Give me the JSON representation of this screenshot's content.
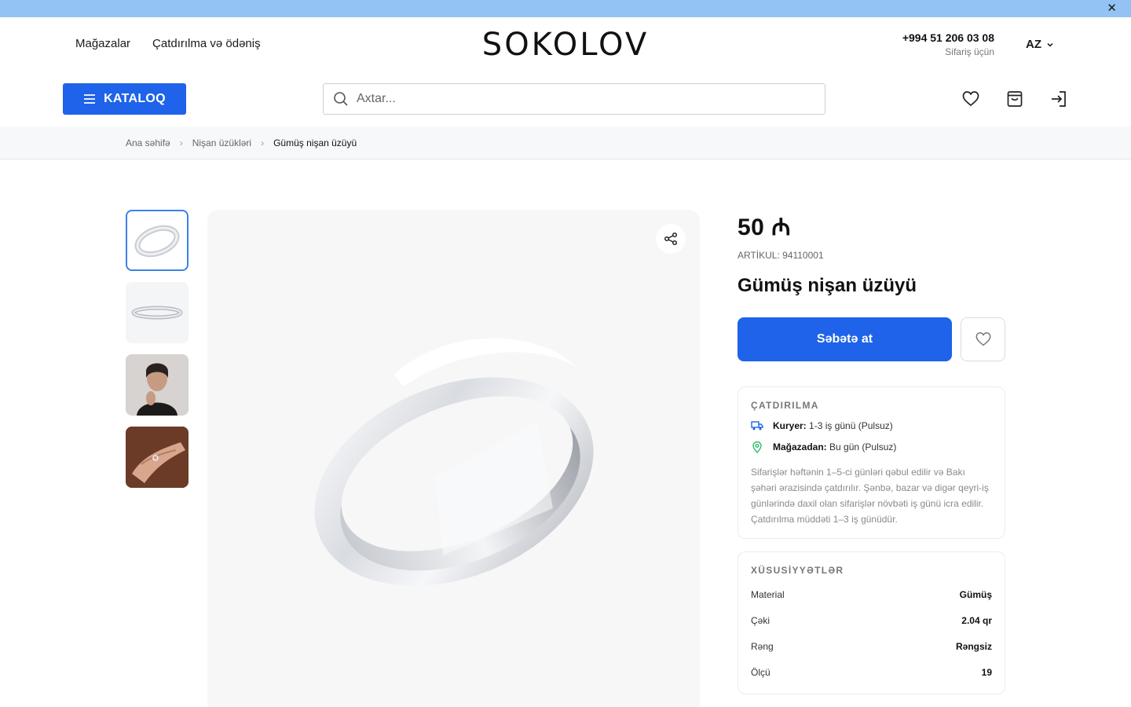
{
  "topbar": {
    "close_label": "✕"
  },
  "header": {
    "nav": [
      "Mağazalar",
      "Çatdırılma və ödəniş"
    ],
    "logo": "SOKOLOV",
    "phone": "+994 51 206 03 08",
    "phone_sub": "Sifariş üçün",
    "lang": "AZ"
  },
  "toolbar": {
    "catalog_label": "KATALOQ",
    "search_placeholder": "Axtar...",
    "icons": [
      "heart-icon",
      "bag-icon",
      "login-icon"
    ]
  },
  "breadcrumb": [
    "Ana səhifə",
    "Nişan üzükləri",
    "Gümüş nişan üzüyü"
  ],
  "product": {
    "price": "50 ₼",
    "sku": "ARTİKUL: 94110001",
    "title": "Gümüş nişan üzüyü",
    "cart_label": "Səbətə at"
  },
  "delivery": {
    "title": "ÇATDIRILMA",
    "courier_label": "Kuryer:",
    "courier_value": " 1-3 iş günü (Pulsuz)",
    "store_label": "Mağazadan:",
    "store_value": " Bu gün (Pulsuz)",
    "note": "Sifarişlər həftənin 1–5-ci günləri qəbul edilir və Bakı şəhəri ərazisində çatdırılır. Şənbə, bazar və digər qeyri-iş günlərində daxil olan sifarişlər növbəti iş günü icra edilir. Çatdırılma müddəti 1–3 iş günüdür."
  },
  "specs": {
    "title": "XÜSUSİYYƏTLƏR",
    "rows": [
      {
        "k": "Material",
        "v": "Gümüş"
      },
      {
        "k": "Çəki",
        "v": "2.04 qr"
      },
      {
        "k": "Rəng",
        "v": "Rəngsiz"
      },
      {
        "k": "Ölçü",
        "v": "19"
      }
    ]
  },
  "colors": {
    "accent": "#1e63e9",
    "topbar": "#93c2f5",
    "thumb_active": "#3a82e6",
    "store_pin": "#2fb86b"
  }
}
